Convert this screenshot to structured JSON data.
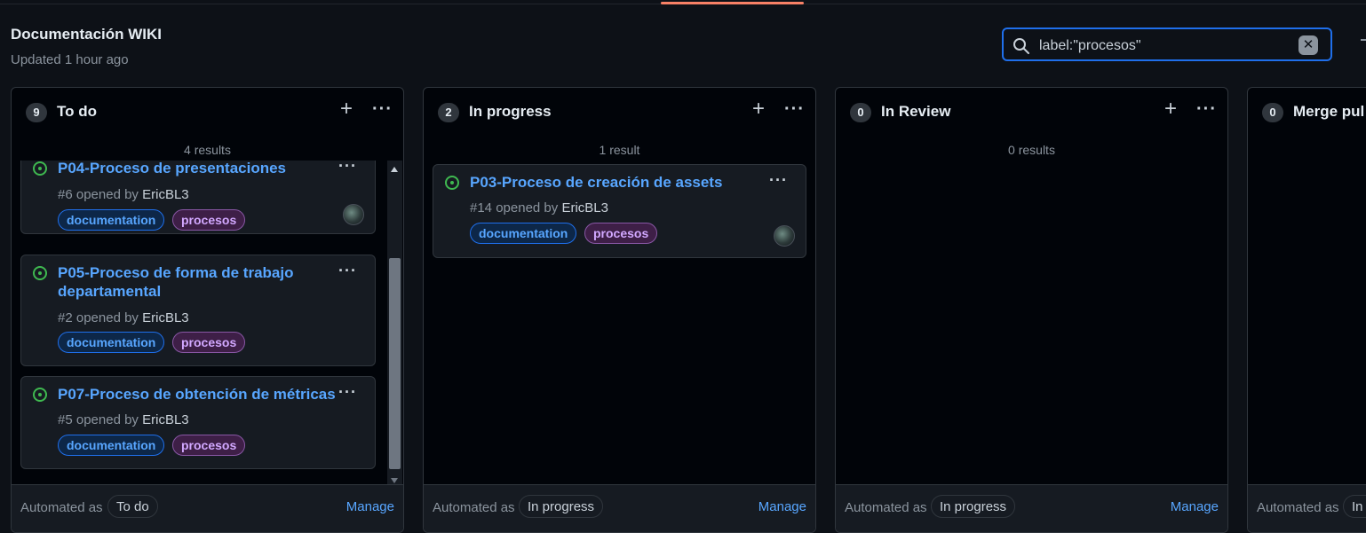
{
  "project": {
    "title": "Documentación WIKI",
    "updated": "Updated 1 hour ago"
  },
  "search": {
    "value": "label:\"procesos\"",
    "clear_label": "✕"
  },
  "columns": [
    {
      "count": "9",
      "name": "To do",
      "results": "4 results",
      "automated_text": "Automated as",
      "automated_badge": "To do",
      "manage": "Manage",
      "cards": [
        {
          "title": "P04-Proceso de presentaciones",
          "number": "#6",
          "opened_by": "opened by",
          "author": "EricBL3",
          "labels": [
            "documentation",
            "procesos"
          ]
        },
        {
          "title": "P05-Proceso de forma de trabajo departamental",
          "number": "#2",
          "opened_by": "opened by",
          "author": "EricBL3",
          "labels": [
            "documentation",
            "procesos"
          ]
        },
        {
          "title": "P07-Proceso de obtención de métricas",
          "number": "#5",
          "opened_by": "opened by",
          "author": "EricBL3",
          "labels": [
            "documentation",
            "procesos"
          ]
        }
      ]
    },
    {
      "count": "2",
      "name": "In progress",
      "results": "1 result",
      "automated_text": "Automated as",
      "automated_badge": "In progress",
      "manage": "Manage",
      "cards": [
        {
          "title": "P03-Proceso de creación de assets",
          "number": "#14",
          "opened_by": "opened by",
          "author": "EricBL3",
          "labels": [
            "documentation",
            "procesos"
          ]
        }
      ]
    },
    {
      "count": "0",
      "name": "In Review",
      "results": "0 results",
      "automated_text": "Automated as",
      "automated_badge": "In progress",
      "manage": "Manage",
      "cards": []
    },
    {
      "count": "0",
      "name": "Merge pul",
      "results": "",
      "automated_text": "Automated as",
      "automated_badge": "In",
      "manage": "",
      "cards": []
    }
  ],
  "colors": {
    "accent": "#f78166",
    "link": "#58a6ff",
    "open_status": "#3fb950",
    "label_doc": "#58a6ff",
    "label_proc": "#d2a8ff"
  }
}
